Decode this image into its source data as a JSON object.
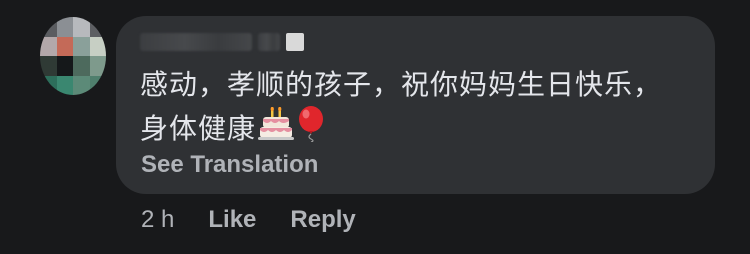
{
  "comment": {
    "text_line1": "感动，孝顺的孩子，祝你妈妈生日快乐，",
    "text_line2": "身体健康",
    "emojis": [
      "birthday-cake",
      "red-balloon"
    ],
    "see_translation_label": "See Translation"
  },
  "actions": {
    "time": "2 h",
    "like_label": "Like",
    "reply_label": "Reply"
  },
  "colors": {
    "background": "#18191b",
    "bubble": "#2f3134",
    "text": "#e4e6eb",
    "secondary_text": "#b0b3b8"
  }
}
